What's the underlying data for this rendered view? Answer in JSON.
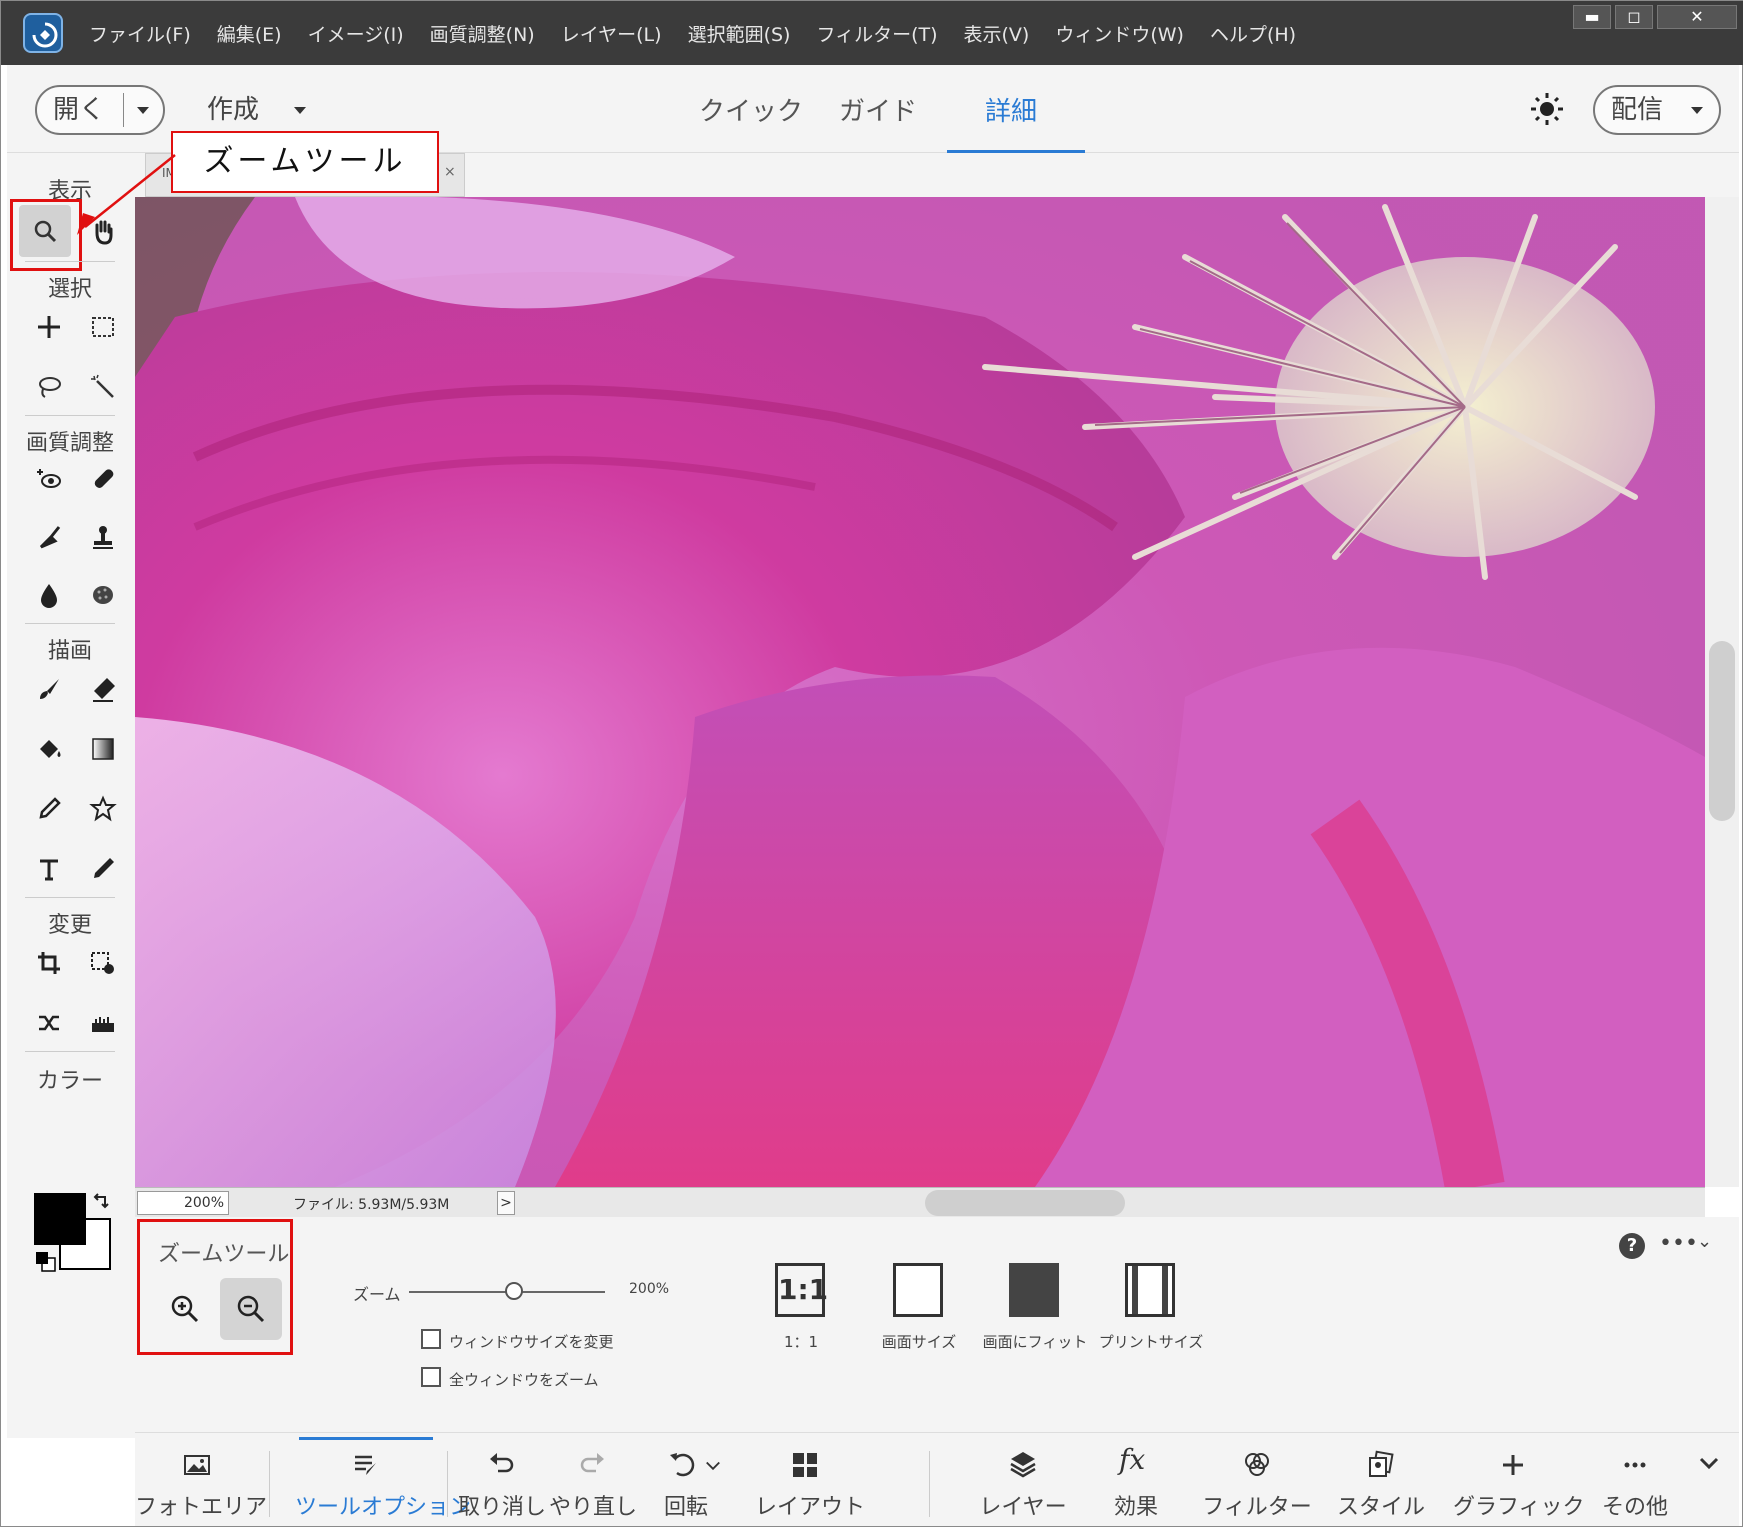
{
  "titlebar": {
    "menu": [
      "ファイル(F)",
      "編集(E)",
      "イメージ(I)",
      "画質調整(N)",
      "レイヤー(L)",
      "選択範囲(S)",
      "フィルター(T)",
      "表示(V)",
      "ウィンドウ(W)",
      "ヘルプ(H)"
    ],
    "window_buttons": {
      "minimize": "▬",
      "maximize": "◻",
      "close": "✕"
    }
  },
  "header": {
    "open_label": "開く",
    "create_label": "作成",
    "modes": {
      "quick": "クイック",
      "guide": "ガイド",
      "expert": "詳細"
    },
    "active_mode": "expert",
    "share_label": "配信"
  },
  "doc_tab": {
    "name": "IMG"
  },
  "toolbox": {
    "sections": {
      "view": "表示",
      "select": "選択",
      "enhance": "画質調整",
      "draw": "描画",
      "modify": "変更",
      "color": "カラー"
    },
    "icons": [
      "zoom-icon",
      "hand-icon",
      "move-icon",
      "marquee-icon",
      "lasso-icon",
      "magic-wand-icon",
      "red-eye-icon",
      "healing-brush-icon",
      "smart-brush-icon",
      "clone-stamp-icon",
      "blur-icon",
      "sponge-icon",
      "brush-icon",
      "eraser-icon",
      "paint-bucket-icon",
      "gradient-icon",
      "eyedropper-icon",
      "custom-shape-icon",
      "type-icon",
      "pencil-icon",
      "crop-icon",
      "recompose-icon",
      "content-aware-move-icon",
      "straighten-icon"
    ],
    "foreground_color": "#000000",
    "background_color": "#ffffff"
  },
  "callout": {
    "text": "ズームツール",
    "color": "#e01010"
  },
  "status": {
    "zoom": "200%",
    "file": "ファイル: 5.93M/5.93M",
    "arrow": ">"
  },
  "tool_options": {
    "title": "ズームツール",
    "zoom_label": "ズーム",
    "zoom_value": "200%",
    "zoom_level_percent": 200,
    "checkbox_resize": "ウィンドウサイズを変更",
    "checkbox_zoom_all": "全ウィンドウをズーム",
    "view_buttons": {
      "one_to_one": "1：1",
      "fit_screen": "画面サイズ",
      "fill_screen": "画面にフィット",
      "print_size": "プリントサイズ"
    },
    "one_to_one_glyph": "1:1",
    "help": "?",
    "more": "•••",
    "collapse": "⌄"
  },
  "taskbar": {
    "photo_bin": "フォトエリア",
    "tool_options": "ツールオプション",
    "undo": "取り消し",
    "redo": "やり直し",
    "rotate": "回転",
    "layout": "レイアウト",
    "layers": "レイヤー",
    "effects": "効果",
    "filters": "フィルター",
    "styles": "スタイル",
    "graphics": "グラフィック",
    "more": "その他",
    "effects_glyph": "fx"
  },
  "colors": {
    "accent": "#2a7bd4",
    "highlight": "#e01010",
    "titlebar": "#3b3b3b"
  }
}
